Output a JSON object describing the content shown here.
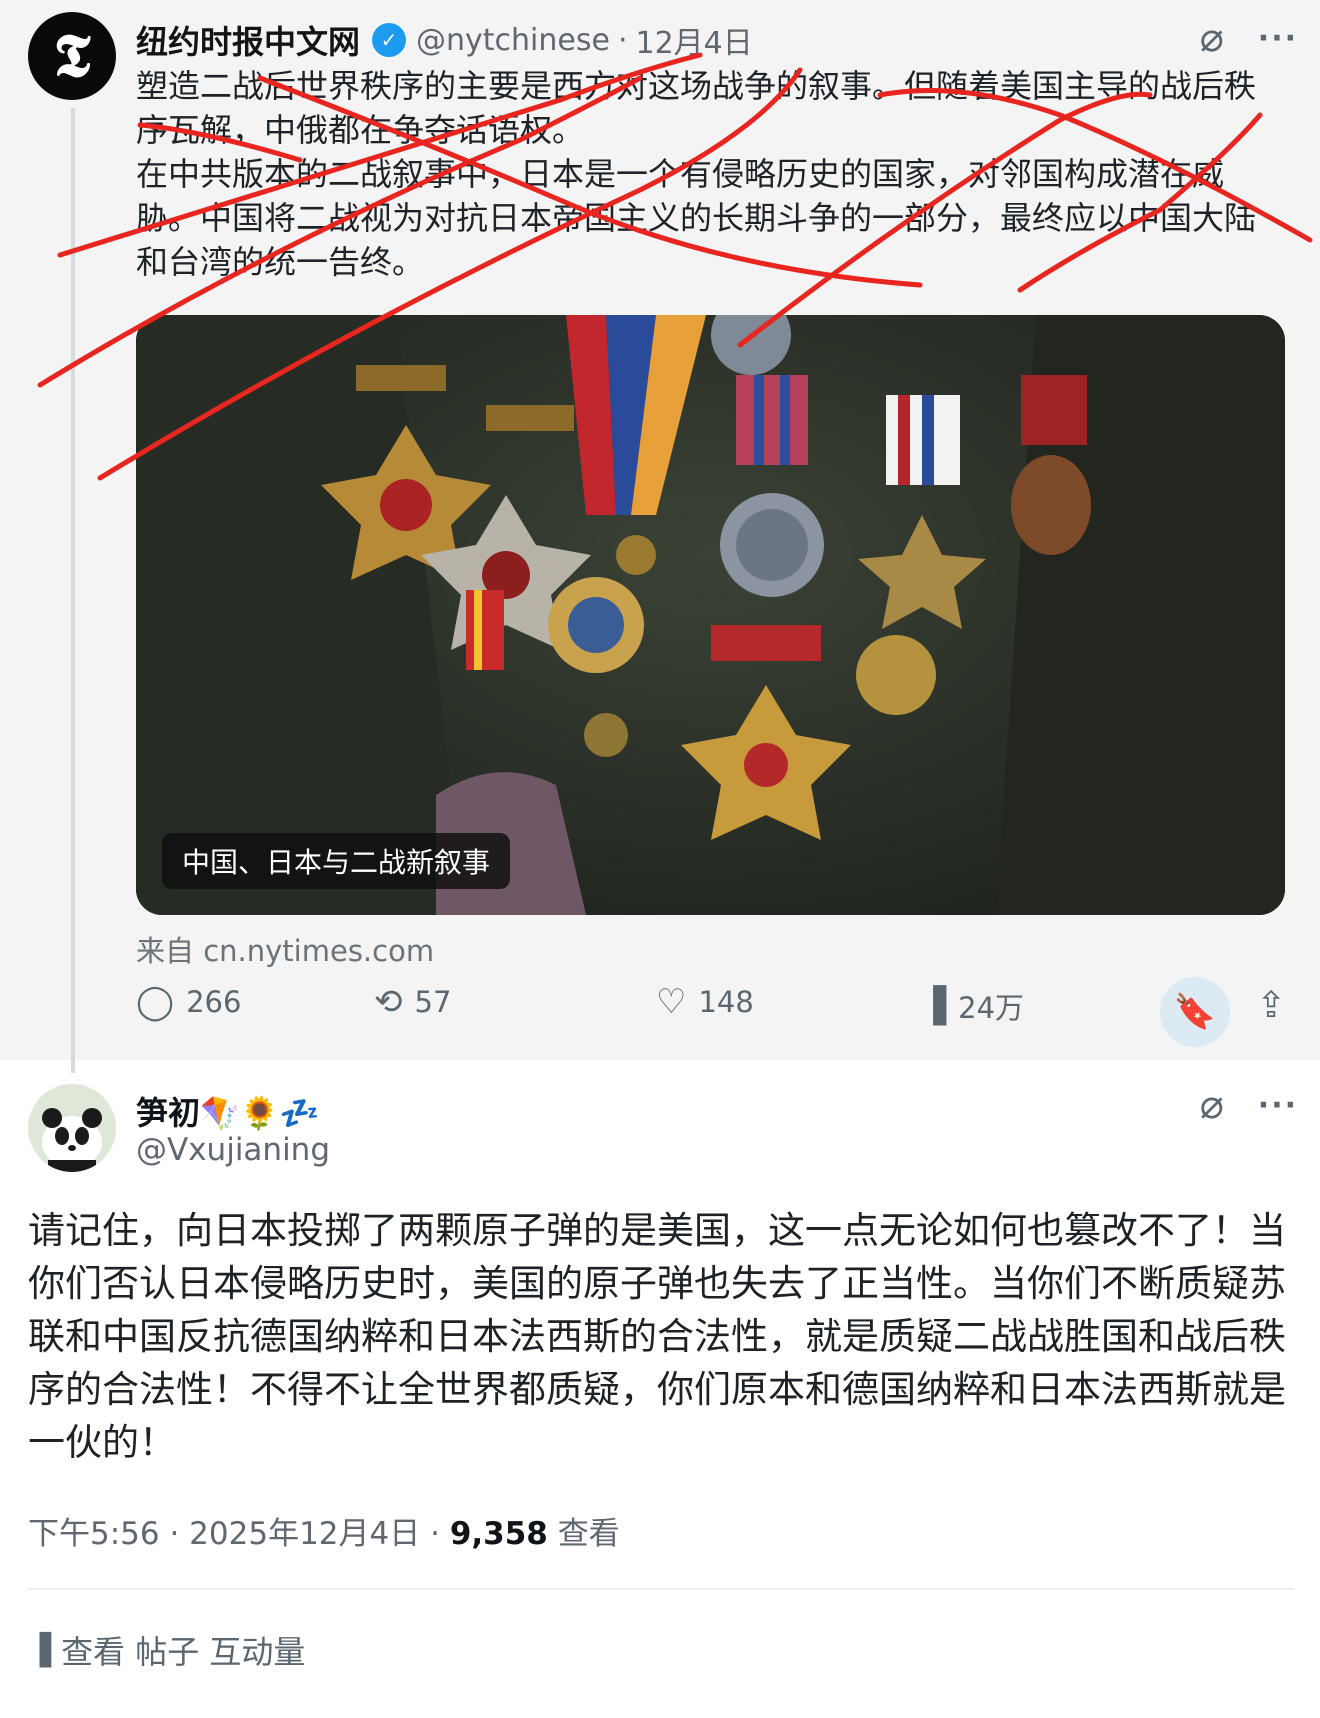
{
  "quoted_tweet": {
    "avatar_glyph": "𝕿",
    "author_name": "纽约时报中文网",
    "verified_glyph": "✓",
    "handle": "@nytchinese",
    "separator": "·",
    "date": "12月4日",
    "text_lines": [
      "塑造二战后世界秩序的主要是西方对这场战争的叙事。但随着美国主导的战后秩序瓦解，中俄都在争夺话语权。",
      "在中共版本的二战叙事中，日本是一个有侵略历史的国家，对邻国构成潜在威胁。中国将二战视为对抗日本帝国主义的长期斗争的一部分，最终应以中国大陆和台湾的统一告终。"
    ],
    "media_caption": "中国、日本与二战新叙事",
    "source": "来自 cn.nytimes.com",
    "replies": "266",
    "retweets": "57",
    "likes": "148",
    "views": "24万"
  },
  "reply_tweet": {
    "author_name": "笋初🪁🌻💤",
    "handle": "@Vxujianing",
    "text": "请记住，向日本投掷了两颗原子弹的是美国，这一点无论如何也篡改不了！当你们否认日本侵略历史时，美国的原子弹也失去了正当性。当你们不断质疑苏联和中国反抗德国纳粹和日本法西斯的合法性，就是质疑二战战胜国和战后秩序的合法性！不得不让全世界都质疑，你们原本和德国纳粹和日本法西斯就是一伙的！",
    "time": "下午5:56 · 2025年12月4日 · ",
    "view_count": "9,358",
    "view_label": " 查看",
    "engagement_label": "查看 帖子 互动量"
  },
  "icons": {
    "grok": "⌀",
    "more": "···",
    "reply": "◯",
    "retweet": "⟲",
    "like": "♡",
    "views": "▐",
    "bookmark": "🔖",
    "share": "⇪"
  },
  "colors": {
    "verified": "#1d9bf0",
    "annotation_red": "#e8251f",
    "bookmark_bg": "#dceaf4"
  }
}
